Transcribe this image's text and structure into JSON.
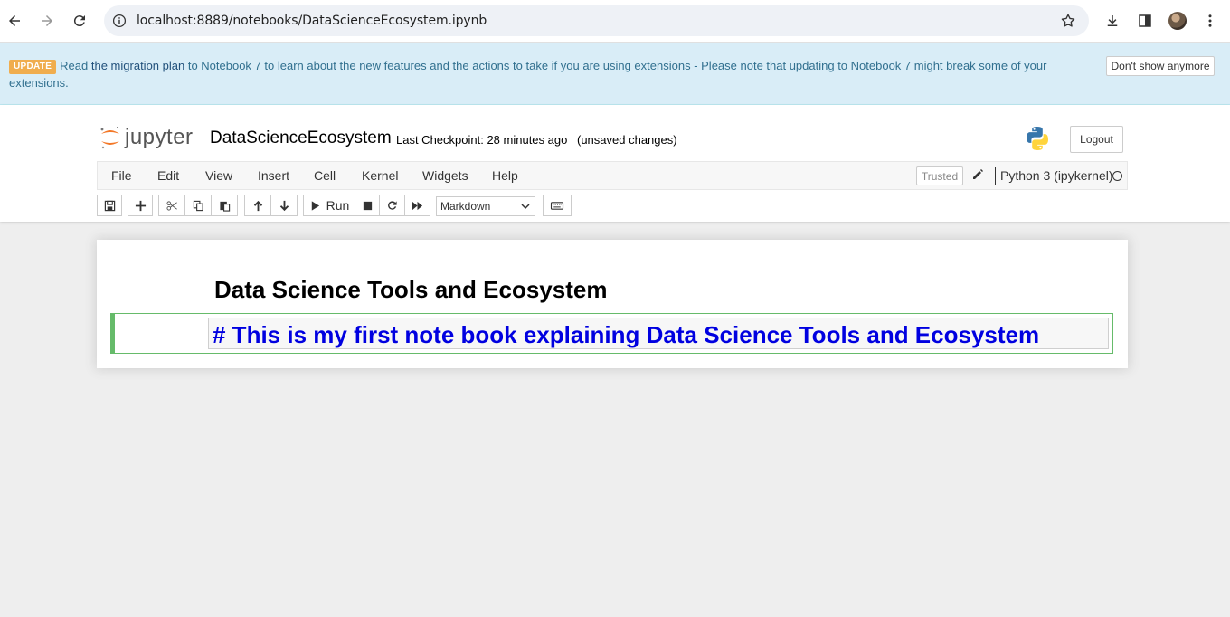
{
  "browser": {
    "url": "localhost:8889/notebooks/DataScienceEcosystem.ipynb"
  },
  "banner": {
    "badge": "UPDATE",
    "text_before": "Read ",
    "link": "the migration plan",
    "text_after": " to Notebook 7 to learn about the new features and the actions to take if you are using extensions - Please note that updating to Notebook 7 might break some of your extensions.",
    "dismiss_label": "Don't show anymore"
  },
  "header": {
    "logo_text": "jupyter",
    "notebook_title": "DataScienceEcosystem",
    "checkpoint": "Last Checkpoint: 28 minutes ago",
    "autosave": "(unsaved changes)",
    "logout_label": "Logout"
  },
  "menubar": {
    "items": [
      "File",
      "Edit",
      "View",
      "Insert",
      "Cell",
      "Kernel",
      "Widgets",
      "Help"
    ],
    "trusted": "Trusted",
    "kernel": "Python 3 (ipykernel)"
  },
  "toolbar": {
    "run_label": "Run",
    "cell_type": "Markdown"
  },
  "notebook": {
    "rendered_heading": "Data Science Tools and Ecosystem",
    "editing_cell_source": "# This is my first note book explaining Data Science Tools and Ecosystem"
  },
  "colors": {
    "banner_bg": "#d9edf7",
    "edit_border": "#66bb6a",
    "markdown_text": "#0000e0",
    "badge": "#f0ad4e"
  }
}
